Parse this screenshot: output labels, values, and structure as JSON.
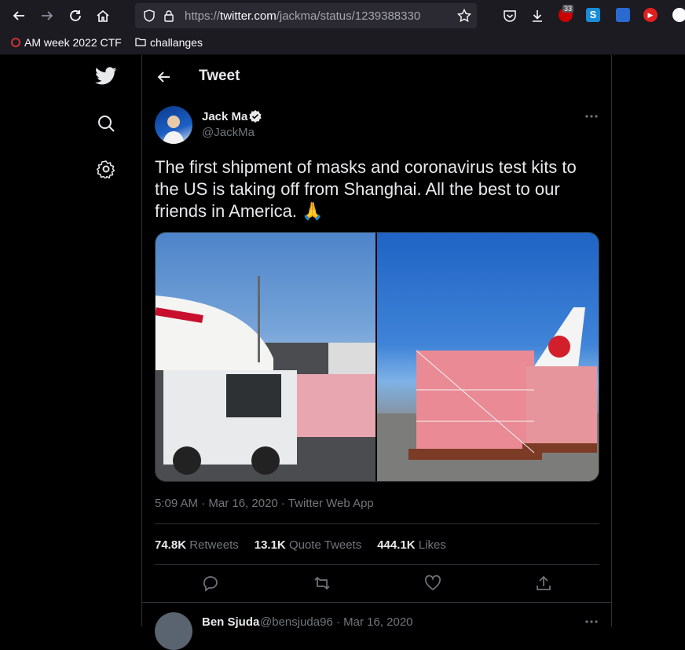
{
  "browser": {
    "url_prefix": "https://",
    "url_host": "twitter.com",
    "url_path": "/jackma/status/1239388330",
    "extension_badge": "33"
  },
  "bookmarks": [
    {
      "label": "AM week 2022 CTF"
    },
    {
      "label": "challanges"
    }
  ],
  "header": {
    "title": "Tweet"
  },
  "tweet": {
    "author_name": "Jack Ma",
    "author_handle": "@JackMa",
    "text": "The first shipment of masks and coronavirus test kits to the US is taking off from Shanghai. All the best to our friends in America. 🙏",
    "timestamp": "5:09 AM · Mar 16, 2020 · Twitter Web App",
    "retweets_count": "74.8K",
    "retweets_label": "Retweets",
    "quote_count": "13.1K",
    "quote_label": "Quote Tweets",
    "likes_count": "444.1K",
    "likes_label": "Likes"
  },
  "reply": {
    "name": "Ben Sjuda",
    "handle_date": "@bensjuda96 · Mar 16, 2020"
  },
  "icons": {
    "back": "arrow-left-icon",
    "more": "more-horizontal-icon"
  },
  "colors": {
    "accent": "#1d9bf0",
    "text_primary": "#e7e9ea",
    "text_secondary": "#71767b",
    "border": "#2f3336"
  }
}
